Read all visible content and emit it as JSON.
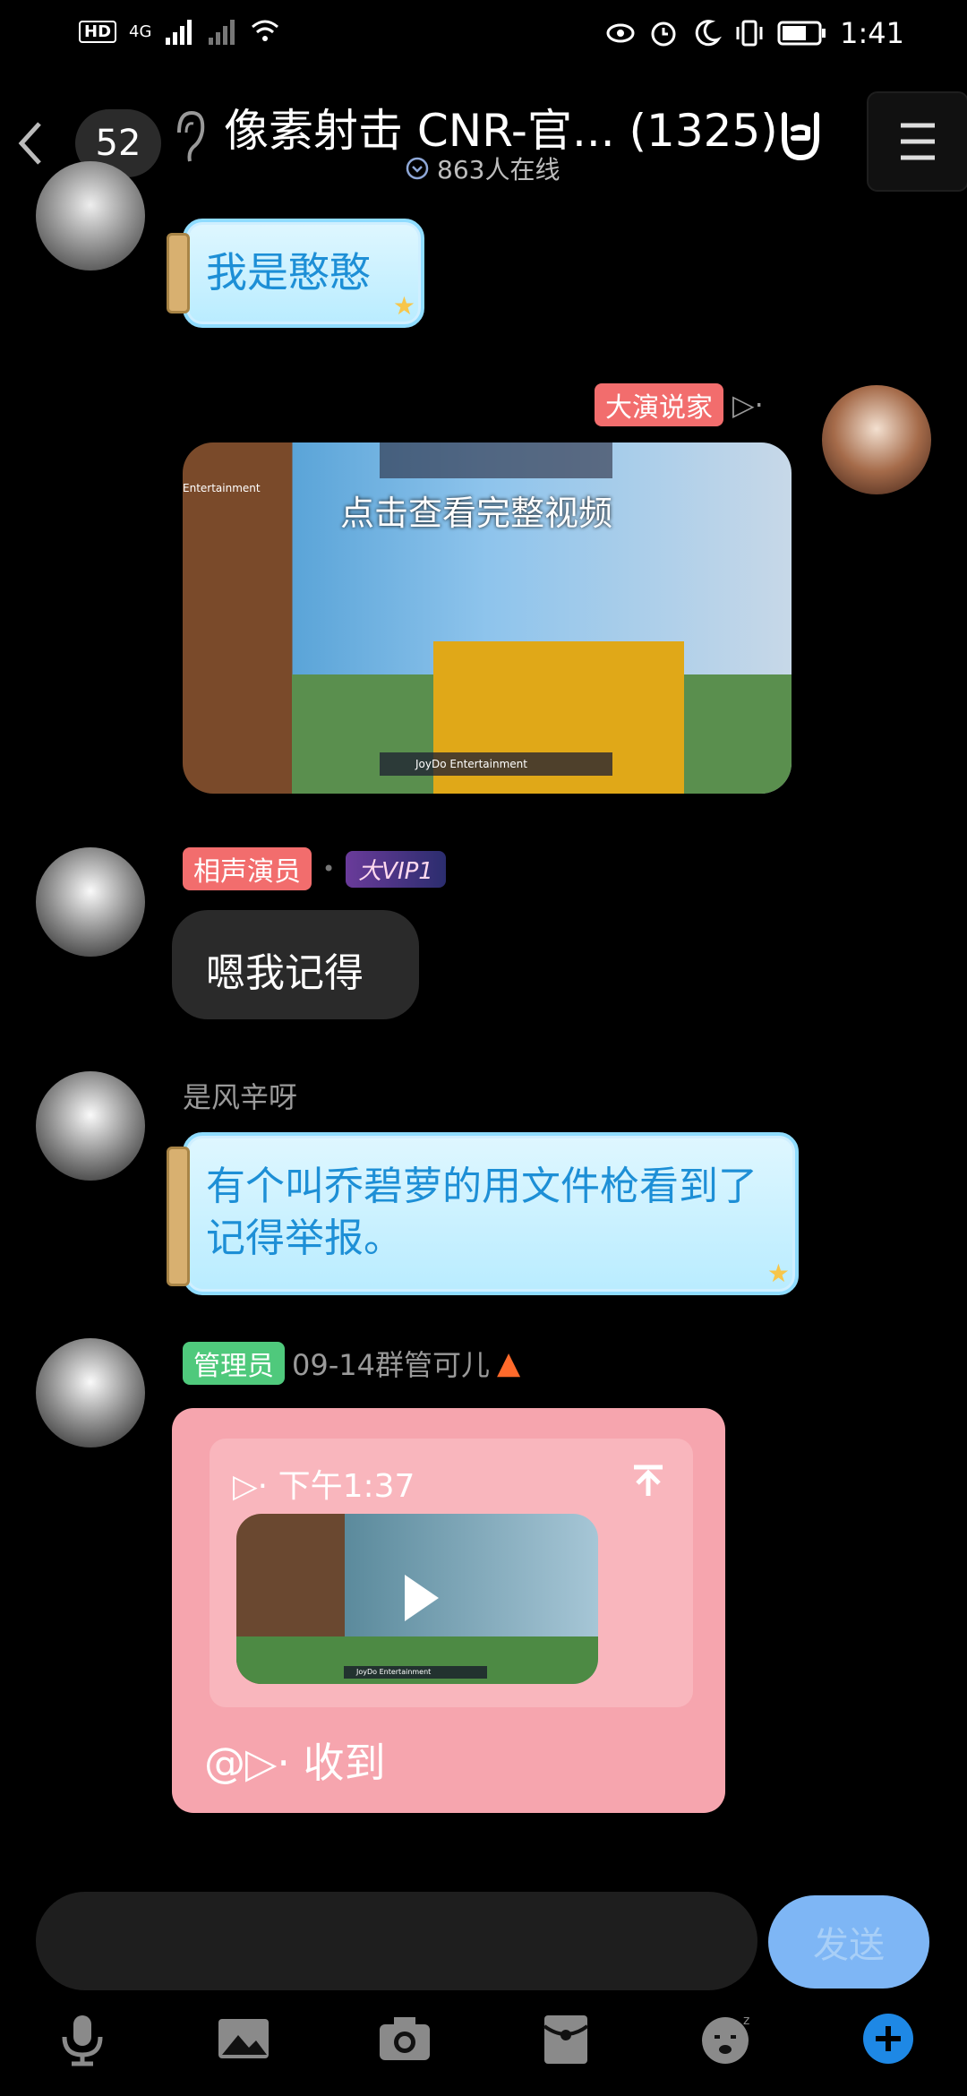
{
  "status_bar": {
    "network_left": "HD",
    "network_4g": "4G",
    "time": "1:41"
  },
  "header": {
    "badge_count": "52",
    "title": "像素射击 CNR-官... (1325)",
    "online_text": "863人在线"
  },
  "messages": [
    {
      "type": "text",
      "text": "我是憨憨"
    },
    {
      "type": "video",
      "sender_tag": "大演说家",
      "sender_suffix": "▷·",
      "caption": "点击查看完整视频",
      "overlay_title": "Entertainment",
      "overlay_bottom": "JoyDo Entertainment"
    },
    {
      "type": "text",
      "sender_tag": "相声演员",
      "vip": "大VIP1",
      "text": "嗯我记得"
    },
    {
      "type": "text",
      "sender_name": "是风辛呀",
      "text": "有个叫乔碧萝的用文件枪看到了记得举报。"
    },
    {
      "type": "reply",
      "sender_tag": "管理员",
      "sender_name": "09-14群管可儿",
      "quote_header": "▷· 下午1:37",
      "reply_text": "@▷·  收到",
      "overlay_bottom": "JoyDo Entertainment"
    }
  ],
  "input": {
    "send_label": "发送"
  },
  "colors": {
    "accent_blue": "#1e88e5",
    "tag_red": "#f26d6d",
    "tag_green": "#4fc97c",
    "bubble_pink": "#f6a5ae"
  }
}
